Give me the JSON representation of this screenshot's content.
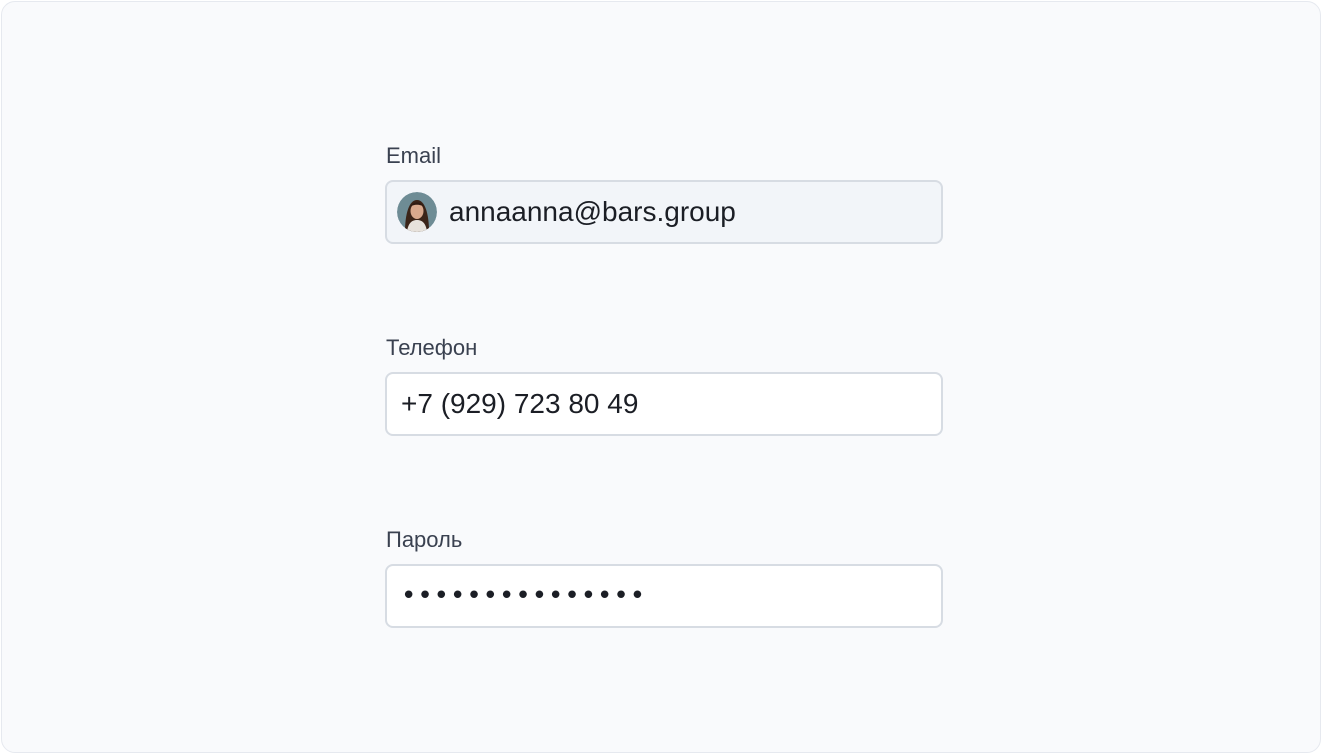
{
  "form": {
    "email": {
      "label": "Email",
      "value": "annaanna@bars.group",
      "avatar_icon": "user-avatar-photo"
    },
    "phone": {
      "label": "Телефон",
      "value": "+7 (929) 723 80 49"
    },
    "password": {
      "label": "Пароль",
      "value": "•••••••••••••••"
    }
  },
  "colors": {
    "card_background": "#f9fafc",
    "input_border": "#d7dce3",
    "readonly_background": "#f2f5f9",
    "label_text": "#3a4150",
    "value_text": "#1b1e25"
  }
}
